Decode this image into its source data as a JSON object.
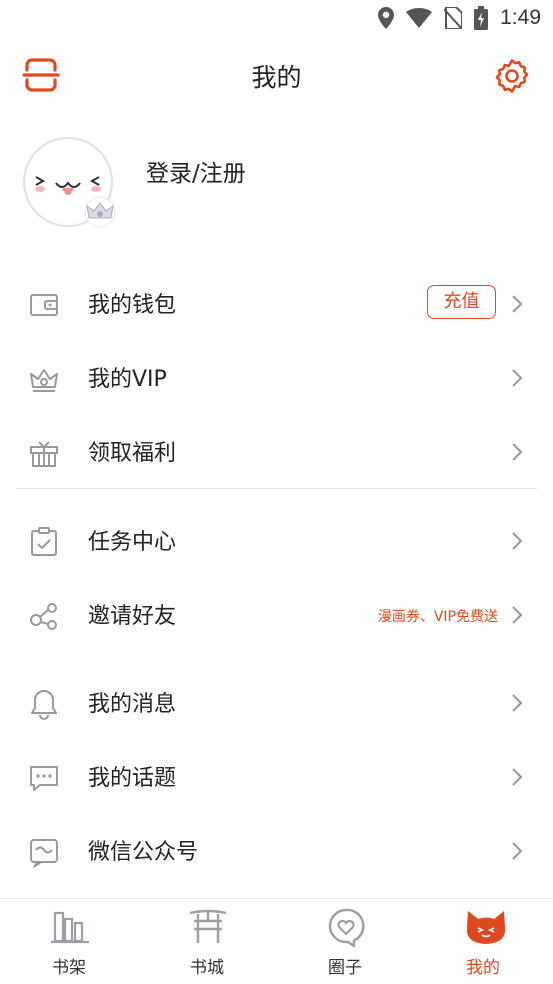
{
  "status_bar": {
    "time": "1:49"
  },
  "header": {
    "title": "我的"
  },
  "profile": {
    "login_text": "登录/注册"
  },
  "menu_group1": [
    {
      "label": "我的钱包",
      "icon": "wallet-icon",
      "action_label": "充值"
    },
    {
      "label": "我的VIP",
      "icon": "crown-icon"
    },
    {
      "label": "领取福利",
      "icon": "gift-icon"
    }
  ],
  "menu_group2": [
    {
      "label": "任务中心",
      "icon": "clipboard-icon"
    },
    {
      "label": "邀请好友",
      "icon": "share-icon",
      "note": "漫画券、VIP免费送"
    }
  ],
  "menu_group3": [
    {
      "label": "我的消息",
      "icon": "bell-icon"
    },
    {
      "label": "我的话题",
      "icon": "chat-icon"
    },
    {
      "label": "微信公众号",
      "icon": "wechat-icon"
    }
  ],
  "tabs": [
    {
      "label": "书架",
      "icon": "bookshelf-icon",
      "active": false
    },
    {
      "label": "书城",
      "icon": "gate-icon",
      "active": false
    },
    {
      "label": "圈子",
      "icon": "heart-chat-icon",
      "active": false
    },
    {
      "label": "我的",
      "icon": "cat-icon",
      "active": true
    }
  ],
  "colors": {
    "accent": "#e0491f",
    "icon_gray": "#9a9a9a",
    "text": "#222222",
    "divider": "#e6e6e6"
  }
}
